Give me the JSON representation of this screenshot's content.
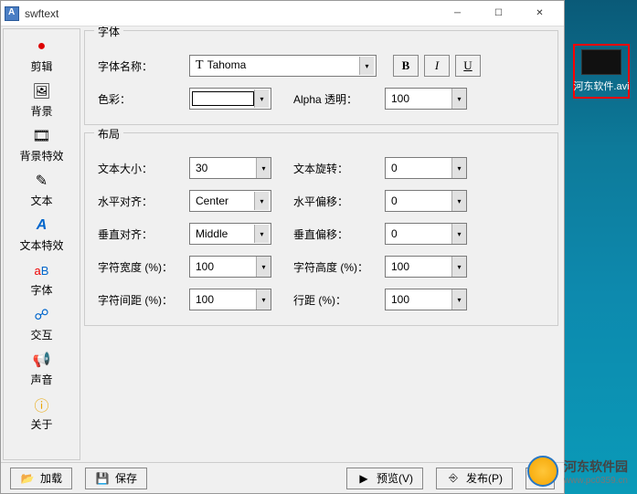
{
  "title": "swftext",
  "sidebar": {
    "items": [
      {
        "label": "剪辑",
        "icon": "🔴"
      },
      {
        "label": "背景",
        "icon": "🖼️"
      },
      {
        "label": "背景特效",
        "icon": "🎞️"
      },
      {
        "label": "文本",
        "icon": "✏️"
      },
      {
        "label": "文本特效",
        "icon": "🅰️"
      },
      {
        "label": "字体",
        "icon": "🔤"
      },
      {
        "label": "交互",
        "icon": "🔗"
      },
      {
        "label": "声音",
        "icon": "🔊"
      },
      {
        "label": "关于",
        "icon": "ℹ️"
      }
    ]
  },
  "font_group": {
    "title": "字体",
    "name_label": "字体名称：",
    "name_value": "Tahoma",
    "color_label": "色彩：",
    "alpha_label": "Alpha 透明：",
    "alpha_value": "100",
    "bold": "B",
    "italic": "I",
    "underline": "U"
  },
  "layout_group": {
    "title": "布局",
    "text_size_label": "文本大小：",
    "text_size": "30",
    "text_rotate_label": "文本旋转：",
    "text_rotate": "0",
    "halign_label": "水平对齐：",
    "halign": "Center",
    "hoffset_label": "水平偏移：",
    "hoffset": "0",
    "valign_label": "垂直对齐：",
    "valign": "Middle",
    "voffset_label": "垂直偏移：",
    "voffset": "0",
    "char_w_label": "字符宽度 (%)：",
    "char_w": "100",
    "char_h_label": "字符高度 (%)：",
    "char_h": "100",
    "char_sp_label": "字符间距 (%)：",
    "char_sp": "100",
    "line_sp_label": "行距 (%)：",
    "line_sp": "100"
  },
  "bottom": {
    "load": "加载",
    "save": "保存",
    "preview": "预览(V)",
    "publish": "发布(P)"
  },
  "desktop_file": "河东软件.avi",
  "watermark": {
    "name": "河东软件园",
    "url": "www.pc0359.cn"
  }
}
